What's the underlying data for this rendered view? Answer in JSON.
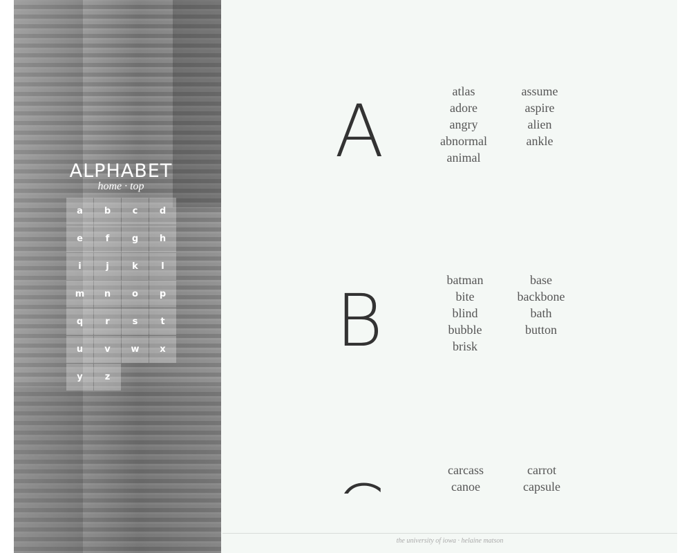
{
  "sidebar": {
    "title": "ALPHABET",
    "nav_home": "home",
    "nav_sep": "·",
    "nav_top": "top",
    "letters": [
      "a",
      "b",
      "c",
      "d",
      "e",
      "f",
      "g",
      "h",
      "i",
      "j",
      "k",
      "l",
      "m",
      "n",
      "o",
      "p",
      "q",
      "r",
      "s",
      "t",
      "u",
      "v",
      "w",
      "x",
      "y",
      "z"
    ]
  },
  "sections": [
    {
      "letter": "A",
      "col1": [
        "atlas",
        "adore",
        "angry",
        "abnormal",
        "animal"
      ],
      "col2": [
        "assume",
        "aspire",
        "alien",
        "ankle"
      ]
    },
    {
      "letter": "B",
      "col1": [
        "batman",
        "bite",
        "blind",
        "bubble",
        "brisk"
      ],
      "col2": [
        "base",
        "backbone",
        "bath",
        "button"
      ]
    },
    {
      "letter": "C",
      "col1": [
        "carcass",
        "canoe"
      ],
      "col2": [
        "carrot",
        "capsule"
      ]
    }
  ],
  "footer": "the university of iowa · helaine matson"
}
